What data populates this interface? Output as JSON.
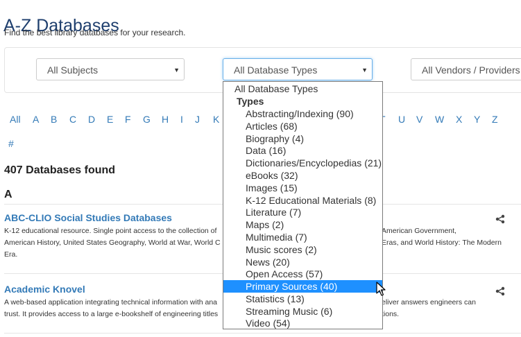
{
  "page": {
    "title": "A-Z Databases",
    "subtitle": "Find the best library databases for your research."
  },
  "filters": {
    "subjects": "All Subjects",
    "types": "All Database Types",
    "vendors": "All Vendors / Providers"
  },
  "az": {
    "letters": [
      "All",
      "A",
      "B",
      "C",
      "D",
      "E",
      "F",
      "G",
      "H",
      "I",
      "J",
      "K",
      "U",
      "V",
      "W",
      "X",
      "Y",
      "Z"
    ],
    "partial": [
      "T"
    ],
    "hash": "#"
  },
  "results": {
    "count": "407 Databases found",
    "section": "A",
    "databases": [
      {
        "title": "ABC-CLIO Social Studies Databases",
        "desc_line1_left": "K-12 educational resource. Single point access to the collection of",
        "desc_line1_right": "American Government,",
        "desc_line2_left": "American History, United States Geography, World at War, World C",
        "desc_line2_right": "Eras, and World History: The Modern",
        "desc_line3": "Era."
      },
      {
        "title": "Academic Knovel",
        "desc_line1_left": "A web-based application integrating technical information with ana",
        "desc_line1_right": "eliver answers engineers can",
        "desc_line2_left": "trust. It provides access to a large e-bookshelf of engineering titles",
        "desc_line2_right": "tions."
      }
    ]
  },
  "dropdown": {
    "top_option": "All Database Types",
    "group_label": "Types",
    "options": [
      "Abstracting/Indexing (90)",
      "Articles (68)",
      "Biography (4)",
      "Data (16)",
      "Dictionaries/Encyclopedias (21)",
      "eBooks (32)",
      "Images (15)",
      "K-12 Educational Materials (8)",
      "Literature (7)",
      "Maps (2)",
      "Multimedia (7)",
      "Music scores (2)",
      "News (20)",
      "Open Access (57)",
      "Primary Sources (40)",
      "Statistics (13)",
      "Streaming Music (6)",
      "Video (54)"
    ],
    "highlighted": "Primary Sources (40)"
  },
  "icons": {
    "share": "share-icon",
    "caret": "caret-down-icon",
    "cursor": "mouse-pointer-icon"
  },
  "colors": {
    "title": "#1f3f6e",
    "link": "#337ab7",
    "highlight": "#1e90ff",
    "focus": "#66afe9"
  }
}
